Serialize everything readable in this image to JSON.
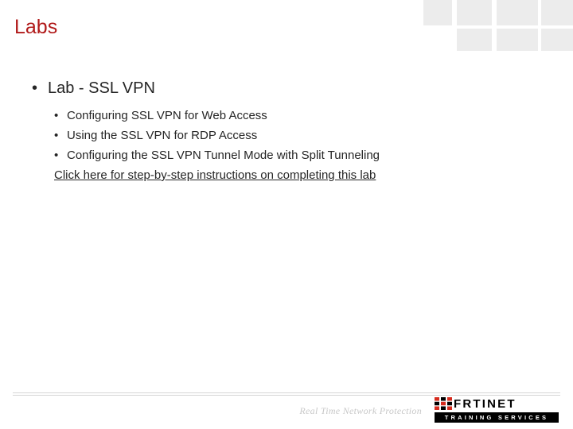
{
  "title": "Labs",
  "content": {
    "lab_heading": "Lab - SSL VPN",
    "items": [
      "Configuring SSL VPN for Web Access",
      "Using the SSL VPN for RDP Access",
      "Configuring the SSL VPN Tunnel Mode with Split Tunneling"
    ],
    "link_text": "Click here for step-by-step instructions on completing this lab"
  },
  "footer": {
    "tagline": "Real Time Network Protection",
    "brand_name": "RTINET",
    "brand_sub": "TRAINING SERVICES"
  }
}
